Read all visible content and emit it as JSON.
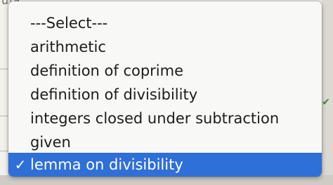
{
  "background": {
    "top_text": "ula"
  },
  "dropdown": {
    "items": [
      {
        "label": "---Select---",
        "selected": false,
        "check": ""
      },
      {
        "label": "arithmetic",
        "selected": false,
        "check": ""
      },
      {
        "label": "definition of coprime",
        "selected": false,
        "check": ""
      },
      {
        "label": "definition of divisibility",
        "selected": false,
        "check": ""
      },
      {
        "label": "integers closed under subtraction",
        "selected": false,
        "check": ""
      },
      {
        "label": "given",
        "selected": false,
        "check": ""
      },
      {
        "label": "lemma on divisibility",
        "selected": true,
        "check": "✓"
      }
    ],
    "selected_value": "lemma on divisibility",
    "highlight_color": "#2f6fd8"
  }
}
